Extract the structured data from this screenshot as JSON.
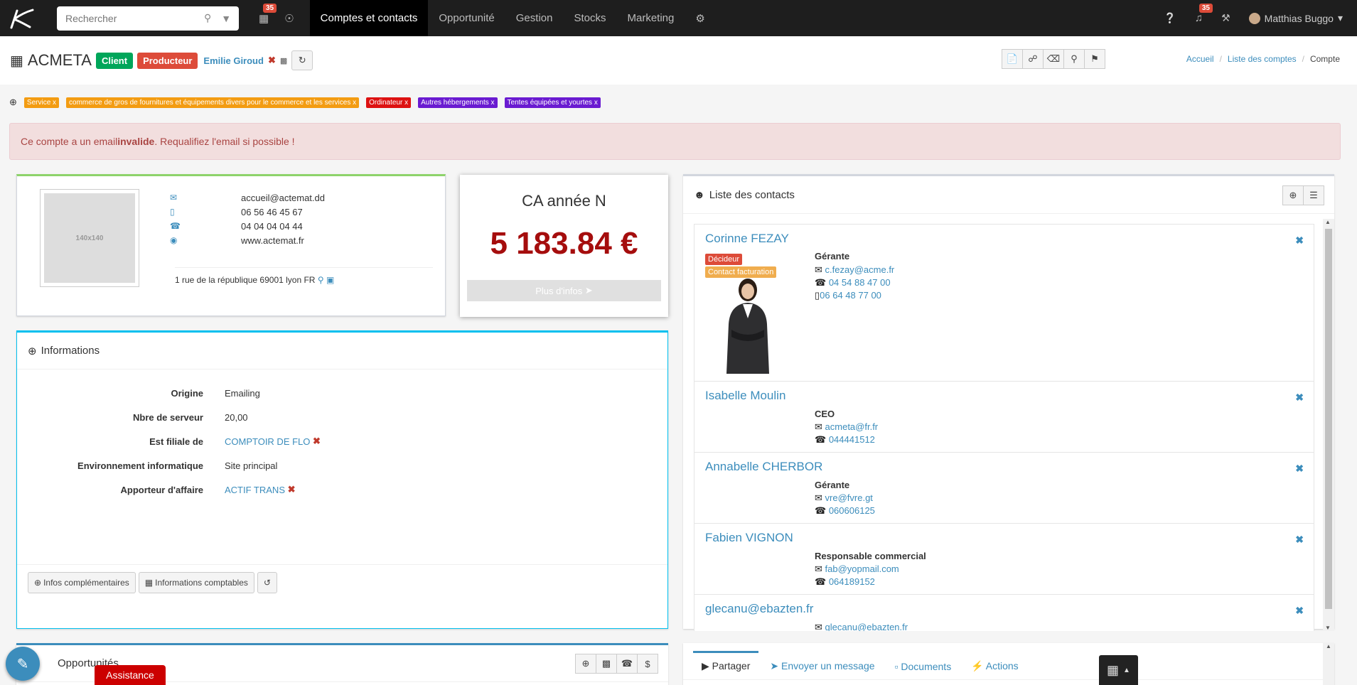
{
  "search": {
    "placeholder": "Rechercher"
  },
  "nav": {
    "calendar_badge": "35",
    "menu": [
      "Comptes et contacts",
      "Opportunité",
      "Gestion",
      "Stocks",
      "Marketing"
    ],
    "notif_badge": "35",
    "user": "Matthias Buggo"
  },
  "account": {
    "name": "ACMETA",
    "label_client": "Client",
    "label_producer": "Producteur",
    "owner": "Emilie Giroud"
  },
  "breadcrumb": [
    "Accueil",
    "Liste des comptes",
    "Compte"
  ],
  "tags": [
    {
      "label": "Service x",
      "color": "#f39c12"
    },
    {
      "label": "commerce de gros de fournitures et équipements divers pour le commerce et les services x",
      "color": "#f39c12"
    },
    {
      "label": "Ordinateur x",
      "color": "#dd1111"
    },
    {
      "label": "Autres hébergements x",
      "color": "#6a1bd1"
    },
    {
      "label": "Tentes équipées et yourtes x",
      "color": "#6a1bd1"
    }
  ],
  "alert": {
    "pre": "Ce compte a un email ",
    "bold": "invalide",
    "post": ". Requalifiez l'email si possible !"
  },
  "contact_card": {
    "placeholder": "140x140",
    "email": "accueil@actemat.dd",
    "mobile": "06 56 46 45 67",
    "phone": "04 04 04 04 44",
    "web": "www.actemat.fr",
    "address": "1 rue de la république 69001 lyon FR"
  },
  "ca": {
    "title": "CA année N",
    "value": "5 183.84 €",
    "more": "Plus d'infos"
  },
  "informations": {
    "title": "Informations",
    "rows": [
      {
        "key": "Origine",
        "value": "Emailing"
      },
      {
        "key": "Nbre de serveur",
        "value": "20,00"
      },
      {
        "key": "Est filiale de",
        "value": "COMPTOIR DE FLO"
      },
      {
        "key": "Environnement informatique",
        "value": "Site principal"
      },
      {
        "key": "Apporteur d'affaire",
        "value": "ACTIF TRANS"
      }
    ],
    "btn_more": "Infos complémentaires",
    "btn_compta": "Informations comptables"
  },
  "contacts": {
    "title": "Liste des contacts",
    "items": [
      {
        "name": "Corinne FEZAY",
        "tag1": "Décideur",
        "tag2": "Contact facturation",
        "role": "Gérante",
        "email": "c.fezay@acme.fr",
        "phone": "04 54 88 47 00",
        "mobile": "06 64 48 77 00"
      },
      {
        "name": "Isabelle Moulin",
        "role": "CEO",
        "email": "acmeta@fr.fr",
        "phone": "044441512"
      },
      {
        "name": "Annabelle CHERBOR",
        "role": "Gérante",
        "email": "vre@fvre.gt",
        "phone": "060606125"
      },
      {
        "name": "Fabien VIGNON",
        "role": "Responsable commercial",
        "email": "fab@yopmail.com",
        "phone": "064189152"
      },
      {
        "name": "glecanu@ebazten.fr",
        "email": "glecanu@ebazten.fr"
      }
    ]
  },
  "opportunites": {
    "title": "Opportunités"
  },
  "share_tabs": [
    "Partager",
    "Envoyer un message",
    "Documents",
    "Actions"
  ],
  "assistance": "Assistance"
}
